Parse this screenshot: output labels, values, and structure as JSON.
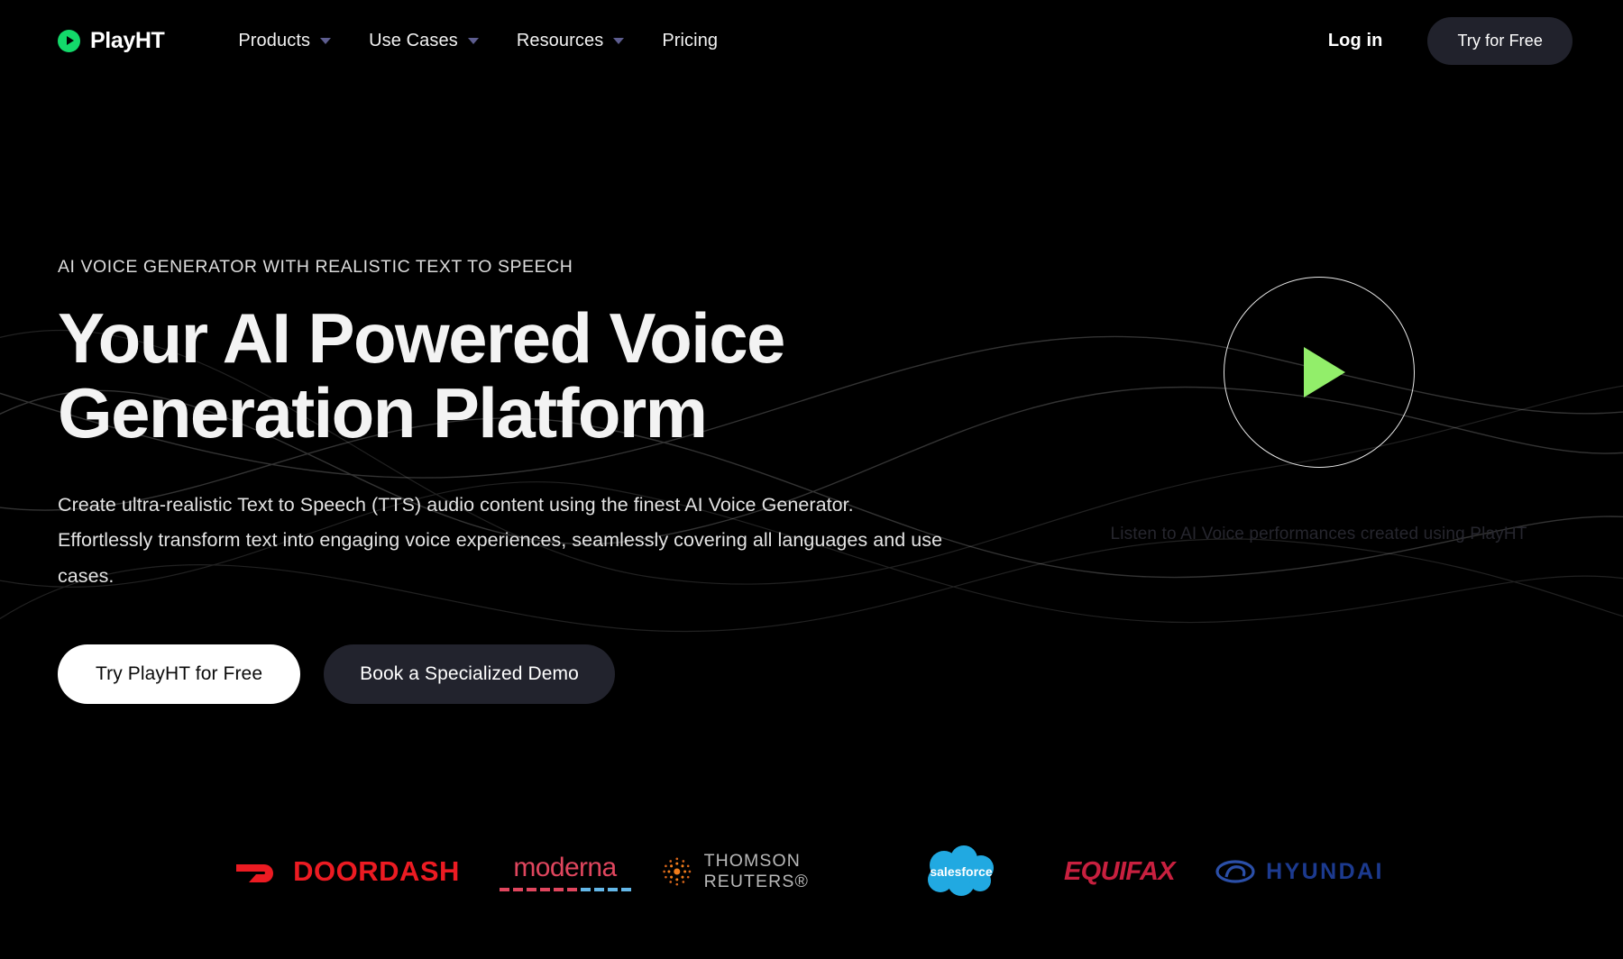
{
  "brand": {
    "name": "PlayHT",
    "mark_icon": "play-circle-icon",
    "accent": "#13D96A"
  },
  "nav": {
    "items": [
      {
        "label": "Products",
        "has_dropdown": true
      },
      {
        "label": "Use Cases",
        "has_dropdown": true
      },
      {
        "label": "Resources",
        "has_dropdown": true
      },
      {
        "label": "Pricing",
        "has_dropdown": false
      }
    ],
    "login_label": "Log in",
    "cta_label": "Try for Free"
  },
  "hero": {
    "eyebrow": "AI VOICE GENERATOR WITH REALISTIC TEXT TO SPEECH",
    "headline_line1": "Your AI Powered Voice",
    "headline_line2": "Generation Platform",
    "subcopy": "Create ultra-realistic Text to Speech (TTS) audio content using the finest AI Voice Generator. Effortlessly transform text into engaging voice experiences, seamlessly covering all languages and use cases.",
    "primary_cta": "Try PlayHT for Free",
    "secondary_cta": "Book a Specialized Demo"
  },
  "video": {
    "play_icon": "play-triangle-icon",
    "caption": "Listen to AI Voice performances created using PlayHT",
    "play_color": "#92ee6a"
  },
  "logos": {
    "items": [
      {
        "name": "DoorDash",
        "text": "DOORDASH",
        "color": "#ec1b22"
      },
      {
        "name": "Moderna",
        "text": "moderna",
        "color": "#e0465e"
      },
      {
        "name": "Thomson Reuters",
        "text": "THOMSON REUTERS®",
        "color": "#b9b9b9"
      },
      {
        "name": "Salesforce",
        "text": "salesforce",
        "color": "#00a1e0"
      },
      {
        "name": "Equifax",
        "text": "EQUIFAX",
        "color": "#c8203f"
      },
      {
        "name": "Hyundai",
        "text": "HYUNDAI",
        "color": "#1c3a8f"
      }
    ]
  },
  "theme": {
    "background": "#000000",
    "text": "#ffffff",
    "pill": "#21222c"
  }
}
